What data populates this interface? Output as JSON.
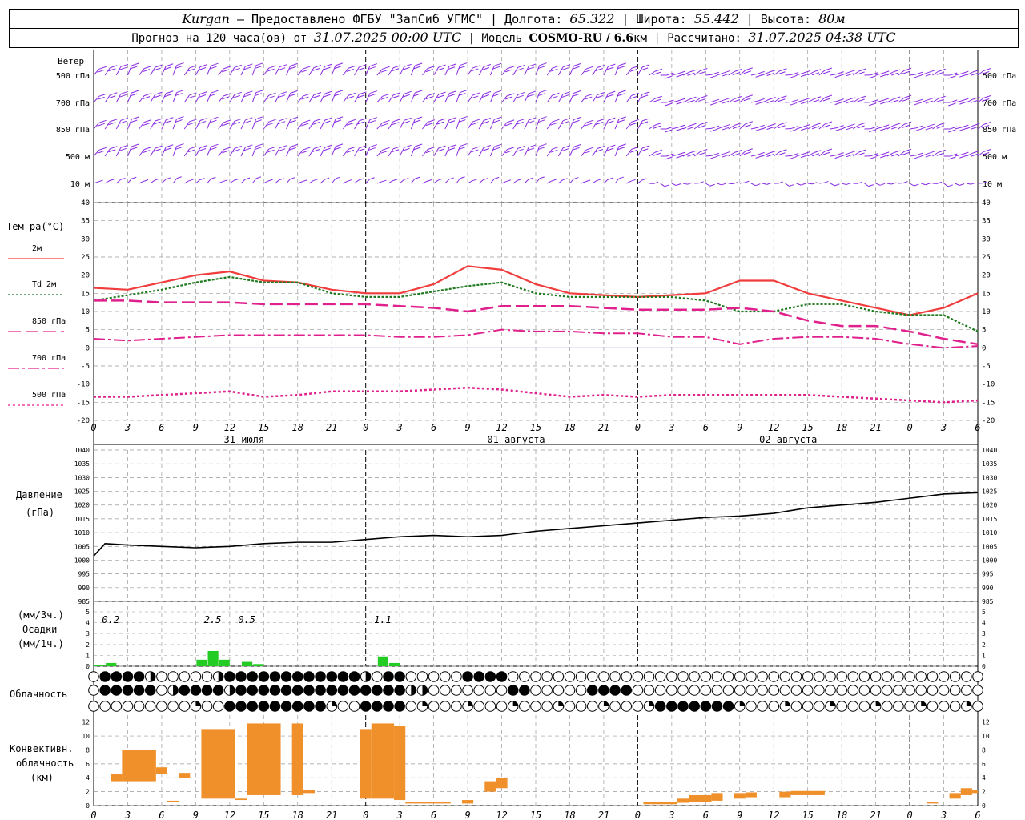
{
  "header": {
    "station": "Kurgan",
    "provider": " — Предоставлено ФГБУ \"ЗапСиб УГМС\" | Долгота: ",
    "lon": "65.322",
    "lat_label": " | Широта: ",
    "lat": "55.442",
    "alt_label": " | Высота: ",
    "alt": "80м",
    "forecast_label": "Прогноз на 120 часа(ов) от ",
    "forecast_time": "31.07.2025 00:00 UTC",
    "model_label": "  | Модель ",
    "model": "COSMO-RU / 6.6",
    "model_unit": "км",
    "calc_label": " | Рассчитано: ",
    "calc_time": "31.07.2025 04:38 UTC"
  },
  "labels": {
    "wind": "Ветер",
    "wind_levels": [
      "500 гПа",
      "700 гПа",
      "850 гПа",
      "500 м",
      "10  м"
    ],
    "temp_title": "Тем-ра(°C)",
    "legend": [
      "2м",
      "Td  2м",
      "850 гПа",
      "700 гПа",
      "500 гПа"
    ],
    "pressure_title": "Давление",
    "pressure_unit": "(гПа)",
    "precip_unit3": "(мм/3ч.)",
    "precip_title": "Осадки",
    "precip_unit1": "(мм/1ч.)",
    "cloud_title": "Облачность",
    "conv_title": [
      "Конвективн.",
      "облачность",
      "(км)"
    ],
    "days": [
      "31 июля",
      "01 августа",
      "02 августа"
    ],
    "hour_ticks": [
      "0",
      "3",
      "6",
      "9",
      "12",
      "15",
      "18",
      "21",
      "0",
      "3",
      "6",
      "9",
      "12",
      "15",
      "18",
      "21",
      "0",
      "3",
      "6",
      "9",
      "12",
      "15",
      "18",
      "21",
      "0",
      "3",
      "6"
    ]
  },
  "colors": {
    "t2m": "#f03c3c",
    "td2m": "#1e7a1e",
    "t850": "#e0208c",
    "t700": "#e0208c",
    "t500": "#e0208c",
    "zero": "#3050d0",
    "wind": "#8a2be2",
    "precip": "#22cc22",
    "conv": "#f0902a",
    "pressure": "#000000"
  },
  "chart_data": [
    {
      "type": "line",
      "title": "Тем-ра(°C)",
      "x_hours": [
        0,
        3,
        6,
        9,
        12,
        15,
        18,
        21,
        24,
        27,
        30,
        33,
        36,
        39,
        42,
        45,
        48,
        51,
        54,
        57,
        60,
        63,
        66,
        69,
        72,
        75,
        78
      ],
      "ylim": [
        -20,
        40
      ],
      "series": [
        {
          "name": "2м",
          "values": [
            16.5,
            16,
            18,
            20,
            21,
            18.5,
            18,
            16,
            15,
            15,
            17.5,
            22.5,
            21.5,
            17.5,
            15,
            14.5,
            14,
            14.5,
            15,
            18.5,
            18.5,
            15,
            13,
            11,
            9,
            11,
            15
          ]
        },
        {
          "name": "Td  2м",
          "values": [
            13,
            14.5,
            16,
            18,
            19.5,
            18,
            18,
            15,
            14,
            14,
            15.5,
            17,
            18,
            15,
            14,
            14,
            14,
            14,
            13,
            10,
            10,
            12,
            12,
            10,
            9,
            9,
            4.5
          ]
        },
        {
          "name": "850 гПа",
          "values": [
            13,
            13,
            12.5,
            12.5,
            12.5,
            12,
            12,
            12,
            12,
            11.5,
            11,
            10,
            11.5,
            11.5,
            11.5,
            11,
            10.5,
            10.5,
            10.5,
            11,
            10,
            7.5,
            6,
            6,
            4.5,
            2.5,
            1
          ]
        },
        {
          "name": "700 гПа",
          "values": [
            2.5,
            2,
            2.5,
            3,
            3.5,
            3.5,
            3.5,
            3.5,
            3.5,
            3,
            3,
            3.5,
            5,
            4.5,
            4.5,
            4,
            4,
            3,
            3,
            1,
            2.5,
            3,
            3,
            2.5,
            1,
            0,
            0.5
          ]
        },
        {
          "name": "500 гПа",
          "values": [
            -13.5,
            -13.5,
            -13,
            -12.5,
            -12,
            -13.5,
            -13,
            -12,
            -12,
            -12,
            -11.5,
            -11,
            -11.5,
            -12.5,
            -13.5,
            -13,
            -13.5,
            -13,
            -13,
            -13,
            -13,
            -13,
            -13.5,
            -14,
            -14.5,
            -15,
            -14.5
          ]
        }
      ]
    },
    {
      "type": "line",
      "title": "Давление",
      "x_hours": [
        0,
        1,
        3,
        6,
        9,
        12,
        15,
        18,
        21,
        24,
        27,
        30,
        33,
        36,
        39,
        42,
        45,
        48,
        51,
        54,
        57,
        60,
        63,
        66,
        69,
        72,
        75,
        78
      ],
      "ylim": [
        985,
        1040
      ],
      "series": [
        {
          "name": "Давление",
          "values": [
            1001.5,
            1006,
            1005.5,
            1005,
            1004.5,
            1005,
            1006,
            1006.5,
            1006.5,
            1007.5,
            1008.5,
            1009,
            1008.5,
            1009,
            1010.5,
            1011.5,
            1012.5,
            1013.5,
            1014.5,
            1015.5,
            1016,
            1017,
            1019,
            1020,
            1021,
            1022.5,
            1024,
            1024.5
          ]
        }
      ]
    },
    {
      "type": "bar",
      "title": "Осадки",
      "ylim": [
        0,
        5
      ],
      "bars_1h": [
        {
          "h": 0,
          "v": 0.1
        },
        {
          "h": 1,
          "v": 0.3
        },
        {
          "h": 9,
          "v": 0.6
        },
        {
          "h": 10,
          "v": 1.4
        },
        {
          "h": 11,
          "v": 0.6
        },
        {
          "h": 13,
          "v": 0.4
        },
        {
          "h": 14,
          "v": 0.2
        },
        {
          "h": 25,
          "v": 0.9
        },
        {
          "h": 26,
          "v": 0.3
        }
      ],
      "annotations": [
        {
          "h": 1.5,
          "text": "0.2"
        },
        {
          "h": 10.5,
          "text": "2.5"
        },
        {
          "h": 13.5,
          "text": "0.5"
        },
        {
          "h": 25.5,
          "text": "1.1"
        }
      ]
    },
    {
      "type": "table",
      "title": "Облачность",
      "rows": [
        "ffffffffffffffffffffffqqhffffffffffhhffffqhhhhhffhhhhhhhhhhhhhhhhhhhhhhhhhhhhhhhhhhhhhhhhhhhhhhh",
        "ffffffffffffffffffffffffffffffffffffffffffffffffffffffffffffffffffffffffffffffffffffffffffffffff",
        "hhhhhhhhhhhhhhhhhhhhhhhhhhhhhhhhhhhhhhhhhhhhhhhhhhhhhhhhhhhhhhhhhhhhhhhhhhhhhhhhhhhhhhhhhhhhhhhh"
      ]
    },
    {
      "type": "bar",
      "title": "Конвективн. облачность (км)",
      "ylim": [
        0,
        13
      ],
      "ranges": [
        {
          "h0": 1.5,
          "h1": 2.5,
          "lo": 3.5,
          "hi": 4.5
        },
        {
          "h0": 2.5,
          "h1": 5.5,
          "lo": 3.5,
          "hi": 8
        },
        {
          "h0": 5.5,
          "h1": 6.5,
          "lo": 4.5,
          "hi": 5.5
        },
        {
          "h0": 6.5,
          "h1": 7.5,
          "lo": 0.5,
          "hi": 0.7
        },
        {
          "h0": 7.5,
          "h1": 8.5,
          "lo": 4,
          "hi": 4.7
        },
        {
          "h0": 9.5,
          "h1": 12.5,
          "lo": 1,
          "hi": 11
        },
        {
          "h0": 12.5,
          "h1": 13.5,
          "lo": 0.8,
          "hi": 1
        },
        {
          "h0": 13.5,
          "h1": 16.5,
          "lo": 1.5,
          "hi": 11.8
        },
        {
          "h0": 17.5,
          "h1": 18.5,
          "lo": 1.5,
          "hi": 11.8
        },
        {
          "h0": 18.5,
          "h1": 19.5,
          "lo": 1.8,
          "hi": 2.2
        },
        {
          "h0": 23.5,
          "h1": 24.5,
          "lo": 1,
          "hi": 11
        },
        {
          "h0": 24.5,
          "h1": 26.5,
          "lo": 1,
          "hi": 11.8
        },
        {
          "h0": 26.5,
          "h1": 27.5,
          "lo": 0.8,
          "hi": 11.5
        },
        {
          "h0": 27.5,
          "h1": 31.5,
          "lo": 0.3,
          "hi": 0.5
        },
        {
          "h0": 32.5,
          "h1": 33.5,
          "lo": 0.3,
          "hi": 0.8
        },
        {
          "h0": 34.5,
          "h1": 35.5,
          "lo": 2,
          "hi": 3.5
        },
        {
          "h0": 35.5,
          "h1": 36.5,
          "lo": 2.5,
          "hi": 4
        },
        {
          "h0": 48.5,
          "h1": 51.5,
          "lo": 0.2,
          "hi": 0.5
        },
        {
          "h0": 51.5,
          "h1": 52.5,
          "lo": 0.4,
          "hi": 1
        },
        {
          "h0": 52.5,
          "h1": 54.5,
          "lo": 0.5,
          "hi": 1.5
        },
        {
          "h0": 54.5,
          "h1": 55.5,
          "lo": 0.7,
          "hi": 1.8
        },
        {
          "h0": 56.5,
          "h1": 57.5,
          "lo": 1,
          "hi": 1.8
        },
        {
          "h0": 57.5,
          "h1": 58.5,
          "lo": 1.2,
          "hi": 1.9
        },
        {
          "h0": 60.5,
          "h1": 61.5,
          "lo": 1.2,
          "hi": 2
        },
        {
          "h0": 61.5,
          "h1": 64.5,
          "lo": 1.5,
          "hi": 2.1
        },
        {
          "h0": 73.5,
          "h1": 74.5,
          "lo": 0.3,
          "hi": 0.5
        },
        {
          "h0": 75.5,
          "h1": 76.5,
          "lo": 1,
          "hi": 1.8
        },
        {
          "h0": 76.5,
          "h1": 77.5,
          "lo": 1.5,
          "hi": 2.5
        },
        {
          "h0": 77.5,
          "h1": 78,
          "lo": 1.8,
          "hi": 2.2
        }
      ]
    }
  ]
}
